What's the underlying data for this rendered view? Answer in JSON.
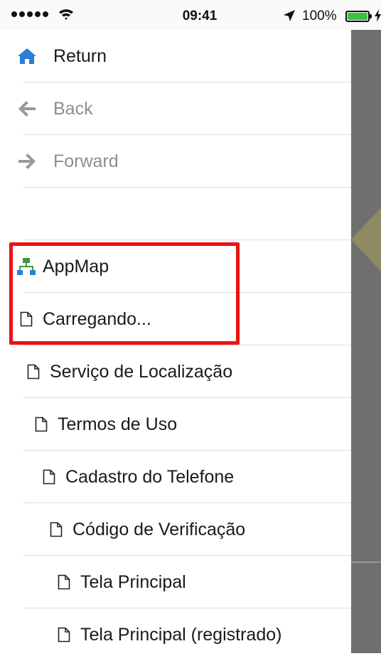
{
  "status_bar": {
    "time": "09:41",
    "battery": "100%",
    "signal_dots": 5,
    "battery_color": "#39c23b"
  },
  "menu": {
    "nav": [
      {
        "label": "Return",
        "icon": "home-icon",
        "enabled": true
      },
      {
        "label": "Back",
        "icon": "arrow-left-icon",
        "enabled": false
      },
      {
        "label": "Forward",
        "icon": "arrow-right-icon",
        "enabled": false
      }
    ],
    "blank": "",
    "appmap": {
      "label": "AppMap",
      "icon": "sitemap-icon"
    },
    "pages": [
      {
        "label": "Carregando...",
        "icon": "document-icon"
      },
      {
        "label": "Serviço de Localização",
        "icon": "document-icon"
      },
      {
        "label": "Termos de Uso",
        "icon": "document-icon"
      },
      {
        "label": "Cadastro do Telefone",
        "icon": "document-icon"
      },
      {
        "label": "Código de Verificação",
        "icon": "document-icon"
      },
      {
        "label": "Tela Principal",
        "icon": "document-icon"
      },
      {
        "label": "Tela Principal (registrado)",
        "icon": "document-icon"
      }
    ]
  },
  "colors": {
    "accent": "#2a7fd6",
    "muted": "#8e8e8e",
    "highlight": "#ee1111",
    "overlay": "#6f6f6f"
  }
}
